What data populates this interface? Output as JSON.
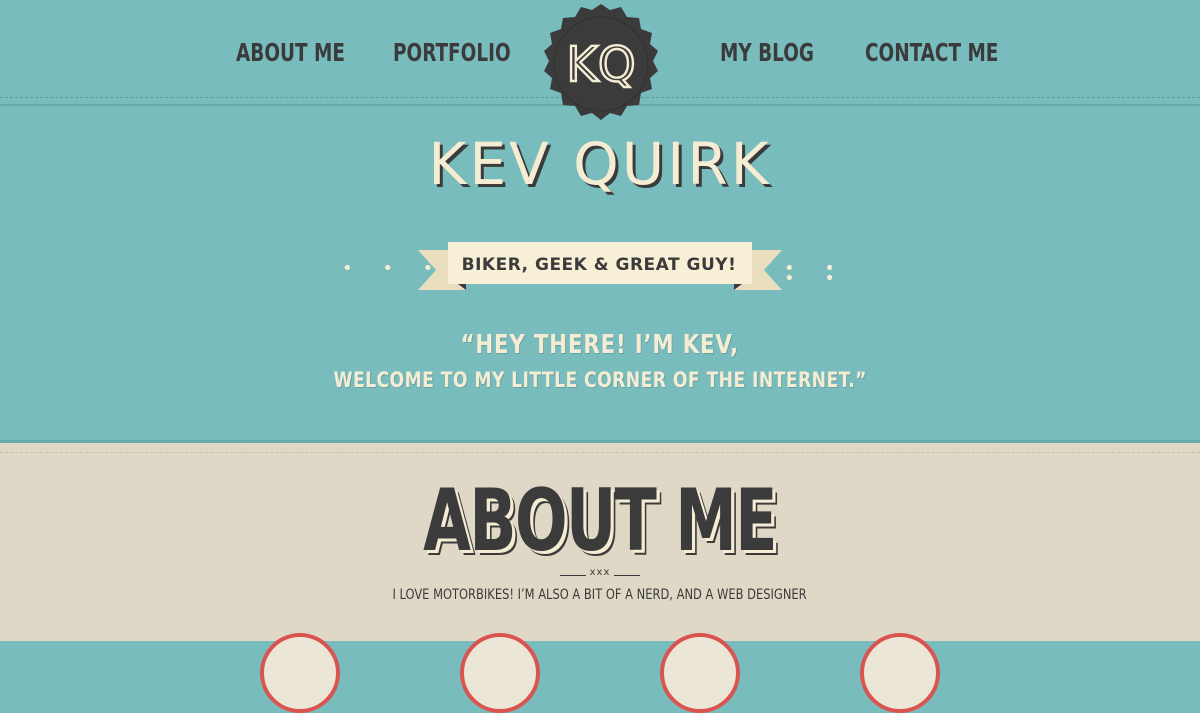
{
  "nav": {
    "items": [
      {
        "label": "ABOUT ME"
      },
      {
        "label": "PORTFOLIO"
      },
      {
        "label": "MY BLOG"
      },
      {
        "label": "CONTACT ME"
      }
    ],
    "logo_text": "KQ"
  },
  "hero": {
    "name": "KEV QUIRK",
    "tagline": "BIKER, GEEK & GREAT GUY!",
    "quote_line1": "“HEY THERE! I’M KEV,",
    "quote_line2": "WELCOME TO MY LITTLE CORNER OF THE INTERNET.”"
  },
  "about": {
    "heading": "ABOUT ME",
    "divider_mark": "xxx",
    "subtitle": "I LOVE MOTORBIKES! I’M ALSO A BIT OF A NERD, AND A WEB DESIGNER"
  },
  "colors": {
    "teal": "#79bcbd",
    "cream": "#f4ecd3",
    "beige": "#dfd8c6",
    "charcoal": "#3b3b3b",
    "accent_red": "#d9534f"
  }
}
